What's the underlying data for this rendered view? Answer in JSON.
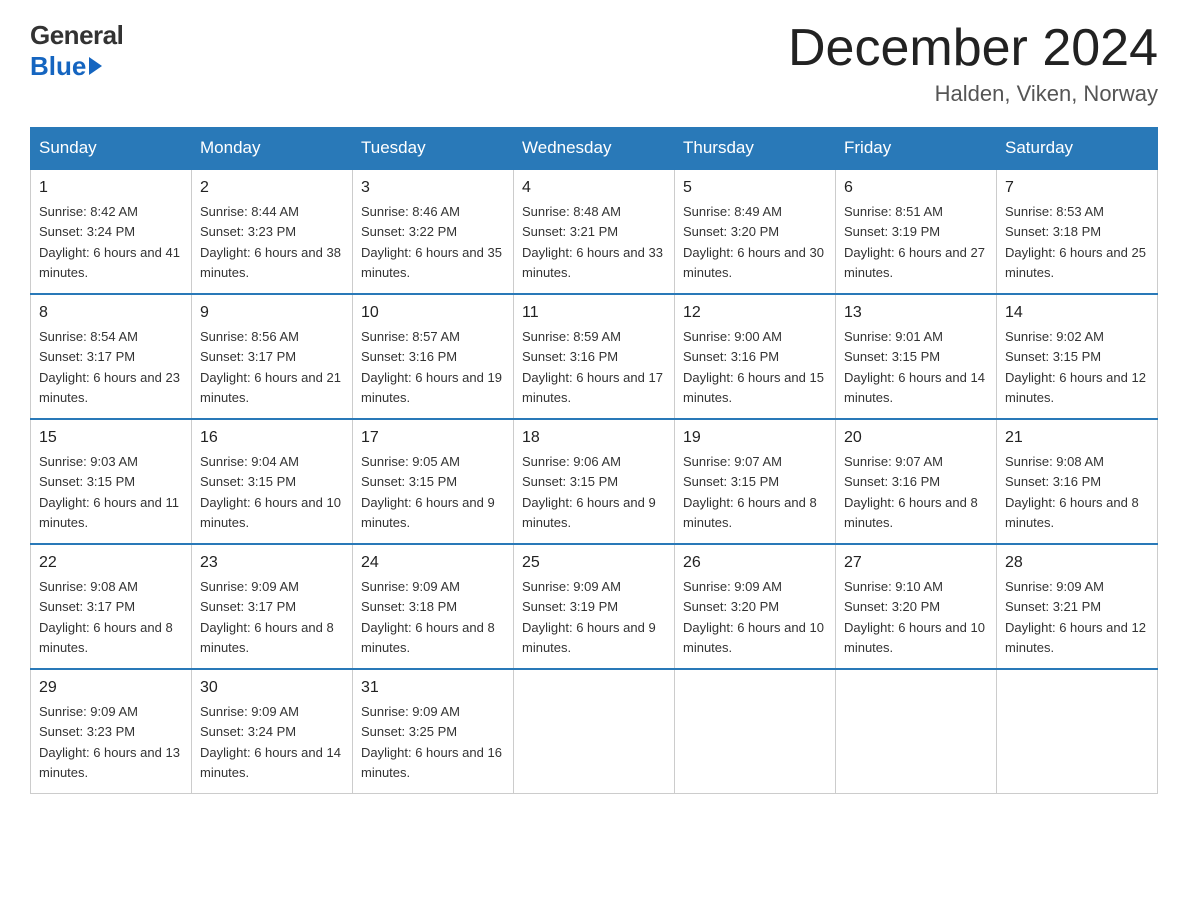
{
  "header": {
    "logo_general": "General",
    "logo_blue": "Blue",
    "month_title": "December 2024",
    "location": "Halden, Viken, Norway"
  },
  "days_of_week": [
    "Sunday",
    "Monday",
    "Tuesday",
    "Wednesday",
    "Thursday",
    "Friday",
    "Saturday"
  ],
  "weeks": [
    [
      {
        "day": "1",
        "sunrise": "8:42 AM",
        "sunset": "3:24 PM",
        "daylight": "6 hours and 41 minutes."
      },
      {
        "day": "2",
        "sunrise": "8:44 AM",
        "sunset": "3:23 PM",
        "daylight": "6 hours and 38 minutes."
      },
      {
        "day": "3",
        "sunrise": "8:46 AM",
        "sunset": "3:22 PM",
        "daylight": "6 hours and 35 minutes."
      },
      {
        "day": "4",
        "sunrise": "8:48 AM",
        "sunset": "3:21 PM",
        "daylight": "6 hours and 33 minutes."
      },
      {
        "day": "5",
        "sunrise": "8:49 AM",
        "sunset": "3:20 PM",
        "daylight": "6 hours and 30 minutes."
      },
      {
        "day": "6",
        "sunrise": "8:51 AM",
        "sunset": "3:19 PM",
        "daylight": "6 hours and 27 minutes."
      },
      {
        "day": "7",
        "sunrise": "8:53 AM",
        "sunset": "3:18 PM",
        "daylight": "6 hours and 25 minutes."
      }
    ],
    [
      {
        "day": "8",
        "sunrise": "8:54 AM",
        "sunset": "3:17 PM",
        "daylight": "6 hours and 23 minutes."
      },
      {
        "day": "9",
        "sunrise": "8:56 AM",
        "sunset": "3:17 PM",
        "daylight": "6 hours and 21 minutes."
      },
      {
        "day": "10",
        "sunrise": "8:57 AM",
        "sunset": "3:16 PM",
        "daylight": "6 hours and 19 minutes."
      },
      {
        "day": "11",
        "sunrise": "8:59 AM",
        "sunset": "3:16 PM",
        "daylight": "6 hours and 17 minutes."
      },
      {
        "day": "12",
        "sunrise": "9:00 AM",
        "sunset": "3:16 PM",
        "daylight": "6 hours and 15 minutes."
      },
      {
        "day": "13",
        "sunrise": "9:01 AM",
        "sunset": "3:15 PM",
        "daylight": "6 hours and 14 minutes."
      },
      {
        "day": "14",
        "sunrise": "9:02 AM",
        "sunset": "3:15 PM",
        "daylight": "6 hours and 12 minutes."
      }
    ],
    [
      {
        "day": "15",
        "sunrise": "9:03 AM",
        "sunset": "3:15 PM",
        "daylight": "6 hours and 11 minutes."
      },
      {
        "day": "16",
        "sunrise": "9:04 AM",
        "sunset": "3:15 PM",
        "daylight": "6 hours and 10 minutes."
      },
      {
        "day": "17",
        "sunrise": "9:05 AM",
        "sunset": "3:15 PM",
        "daylight": "6 hours and 9 minutes."
      },
      {
        "day": "18",
        "sunrise": "9:06 AM",
        "sunset": "3:15 PM",
        "daylight": "6 hours and 9 minutes."
      },
      {
        "day": "19",
        "sunrise": "9:07 AM",
        "sunset": "3:15 PM",
        "daylight": "6 hours and 8 minutes."
      },
      {
        "day": "20",
        "sunrise": "9:07 AM",
        "sunset": "3:16 PM",
        "daylight": "6 hours and 8 minutes."
      },
      {
        "day": "21",
        "sunrise": "9:08 AM",
        "sunset": "3:16 PM",
        "daylight": "6 hours and 8 minutes."
      }
    ],
    [
      {
        "day": "22",
        "sunrise": "9:08 AM",
        "sunset": "3:17 PM",
        "daylight": "6 hours and 8 minutes."
      },
      {
        "day": "23",
        "sunrise": "9:09 AM",
        "sunset": "3:17 PM",
        "daylight": "6 hours and 8 minutes."
      },
      {
        "day": "24",
        "sunrise": "9:09 AM",
        "sunset": "3:18 PM",
        "daylight": "6 hours and 8 minutes."
      },
      {
        "day": "25",
        "sunrise": "9:09 AM",
        "sunset": "3:19 PM",
        "daylight": "6 hours and 9 minutes."
      },
      {
        "day": "26",
        "sunrise": "9:09 AM",
        "sunset": "3:20 PM",
        "daylight": "6 hours and 10 minutes."
      },
      {
        "day": "27",
        "sunrise": "9:10 AM",
        "sunset": "3:20 PM",
        "daylight": "6 hours and 10 minutes."
      },
      {
        "day": "28",
        "sunrise": "9:09 AM",
        "sunset": "3:21 PM",
        "daylight": "6 hours and 12 minutes."
      }
    ],
    [
      {
        "day": "29",
        "sunrise": "9:09 AM",
        "sunset": "3:23 PM",
        "daylight": "6 hours and 13 minutes."
      },
      {
        "day": "30",
        "sunrise": "9:09 AM",
        "sunset": "3:24 PM",
        "daylight": "6 hours and 14 minutes."
      },
      {
        "day": "31",
        "sunrise": "9:09 AM",
        "sunset": "3:25 PM",
        "daylight": "6 hours and 16 minutes."
      },
      null,
      null,
      null,
      null
    ]
  ],
  "labels": {
    "sunrise": "Sunrise:",
    "sunset": "Sunset:",
    "daylight": "Daylight:"
  }
}
